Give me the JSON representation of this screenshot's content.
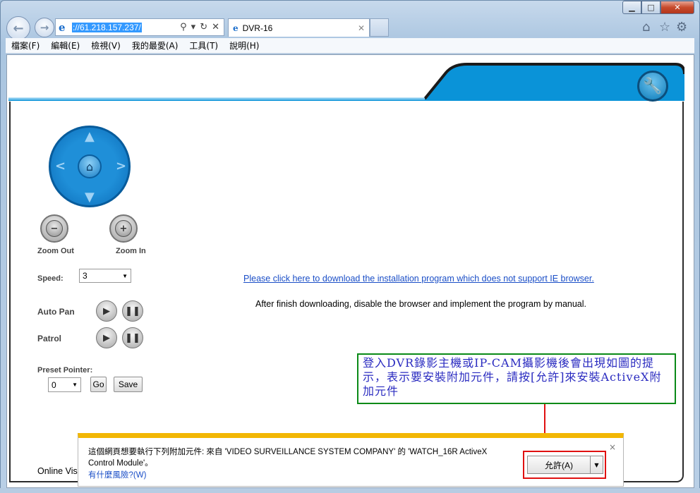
{
  "browser": {
    "address_url": "://61.218.157.237/",
    "tab_title": "DVR-16",
    "tab_icon": "ie-icon",
    "menu": [
      "檔案(F)",
      "編輯(E)",
      "檢視(V)",
      "我的最愛(A)",
      "工具(T)",
      "說明(H)"
    ],
    "window_controls": {
      "minimize": "▁",
      "maximize": "□",
      "close": "✕"
    }
  },
  "ptz": {
    "arrows": {
      "up": "▲",
      "down": "▼",
      "left": "<",
      "right": ">"
    },
    "zoom_out_label": "Zoom Out",
    "zoom_in_label": "Zoom In",
    "speed_label": "Speed:",
    "speed_value": "3",
    "auto_pan_label": "Auto Pan",
    "patrol_label": "Patrol",
    "preset_label": "Preset Pointer:",
    "preset_value": "0",
    "go_label": "Go",
    "save_label": "Save"
  },
  "main": {
    "download_link": "Please click here to download the installation program which does not support IE browser.",
    "after_download_text": "After finish downloading, disable the browser and implement the program by manual.",
    "online_text": "Online Vis"
  },
  "annotation": {
    "text": "登入DVR錄影主機或IP-CAM攝影機後會出現如圖的提示，表示要安裝附加元件，請按[允許]來安裝ActiveX附加元件"
  },
  "infobar": {
    "message": "這個網頁想要執行下列附加元件: 來自 'VIDEO SURVEILLANCE SYSTEM COMPANY' 的 'WATCH_16R ActiveX Control Module'。",
    "risk_link": "有什麼風險?(W)",
    "allow_label": "允許(A)",
    "close": "×"
  },
  "colors": {
    "banner_blue": "#0a93d8",
    "infobar_yellow": "#f2b705",
    "link_blue": "#1a4ec7",
    "note_green": "#0a8a17",
    "note_text": "#2a2bc0",
    "arrow_red": "#e01010"
  }
}
